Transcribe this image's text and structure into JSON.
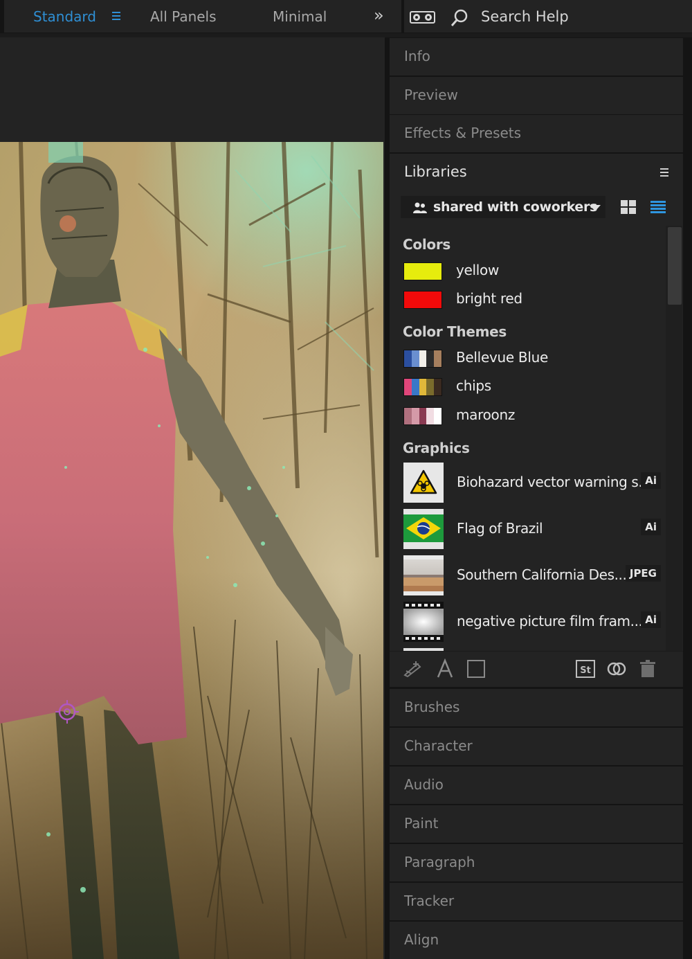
{
  "workspaces": {
    "items": [
      "Standard",
      "All Panels",
      "Minimal"
    ],
    "active": "Standard"
  },
  "search": {
    "label": "Search Help"
  },
  "panels": {
    "top": [
      "Info",
      "Preview",
      "Effects & Presets"
    ],
    "bottom": [
      "Brushes",
      "Character",
      "Audio",
      "Paint",
      "Paragraph",
      "Tracker",
      "Align"
    ]
  },
  "libraries": {
    "title": "Libraries",
    "selected_library": "shared with coworkers",
    "sections": {
      "colors": "Colors",
      "themes": "Color Themes",
      "graphics": "Graphics"
    },
    "colors": [
      {
        "name": "yellow",
        "hex": "#e6ec0d"
      },
      {
        "name": "bright red",
        "hex": "#f20a0a"
      }
    ],
    "themes": [
      {
        "name": "Bellevue Blue",
        "swatches": [
          "#2b4fa0",
          "#6a8fd0",
          "#f2efe9",
          "#2c2c2c",
          "#a67f5e"
        ]
      },
      {
        "name": "chips",
        "swatches": [
          "#e0467a",
          "#3a78c8",
          "#e0b83a",
          "#7a6b2c",
          "#3a2a20"
        ]
      },
      {
        "name": "maroonz",
        "swatches": [
          "#b0707e",
          "#d59aa8",
          "#8a3a52",
          "#f1dde3",
          "#ffffff"
        ]
      }
    ],
    "graphics": [
      {
        "name": "Biohazard vector warning s...",
        "type": "Ai"
      },
      {
        "name": "Flag of Brazil",
        "type": "Ai"
      },
      {
        "name": "Southern California Des...",
        "type": "JPEG"
      },
      {
        "name": "negative picture film fram...",
        "type": "Ai"
      }
    ]
  }
}
